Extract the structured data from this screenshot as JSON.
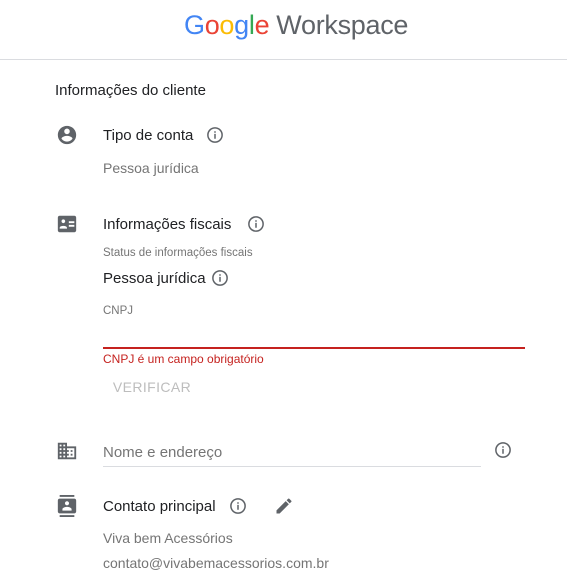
{
  "header": {
    "logo_letters": [
      "G",
      "o",
      "o",
      "g",
      "l",
      "e"
    ],
    "logo_product": "Workspace"
  },
  "section": {
    "title": "Informações do cliente"
  },
  "account_type": {
    "label": "Tipo de conta",
    "value": "Pessoa jurídica"
  },
  "tax_info": {
    "label": "Informações fiscais",
    "status_label": "Status de informações fiscais",
    "status_value": "Pessoa jurídica",
    "cnpj_label": "CNPJ",
    "cnpj_value": "",
    "error": "CNPJ é um campo obrigatório",
    "verify_button": "VERIFICAR"
  },
  "address": {
    "placeholder": "Nome e endereço"
  },
  "contact": {
    "label": "Contato principal",
    "name": "Viva bem Acessórios",
    "email": "contato@vivabemacessorios.com.br"
  },
  "colors": {
    "error": "#c5221f",
    "icon": "#5f6368",
    "disabled": "#bdbdbd"
  }
}
